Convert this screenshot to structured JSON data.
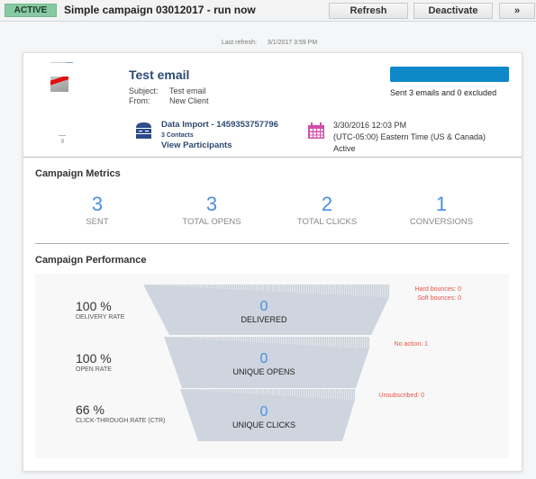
{
  "toolbar": {
    "status": "ACTIVE",
    "campaign_name": "Simple campaign 03012017 - run now",
    "refresh_label": "Refresh",
    "deactivate_label": "Deactivate",
    "more_label": "»"
  },
  "last_refresh": {
    "label": "Last refresh:",
    "value": "3/1/2017 3:59 PM"
  },
  "email": {
    "title": "Test email",
    "subject_label": "Subject:",
    "subject": "Test email",
    "from_label": "From:",
    "from": "New Client"
  },
  "send_status": {
    "progress_percent": 100,
    "text": "Sent 3 emails and 0 excluded",
    "color": "#0f88c8"
  },
  "audience": {
    "icon": "database-icon",
    "name": "Data Import - 1459353757796",
    "contacts": "3 Contacts",
    "view_participants": "View Participants"
  },
  "schedule": {
    "icon": "calendar-icon",
    "datetime": "3/30/2016 12:03 PM",
    "timezone": "(UTC-05:00) Eastern Time (US & Canada)",
    "state": "Active"
  },
  "metrics": {
    "title": "Campaign Metrics",
    "items": [
      {
        "value": "3",
        "label": "SENT"
      },
      {
        "value": "3",
        "label": "TOTAL OPENS"
      },
      {
        "value": "2",
        "label": "TOTAL CLICKS"
      },
      {
        "value": "1",
        "label": "CONVERSIONS"
      }
    ]
  },
  "performance": {
    "title": "Campaign Performance",
    "stages": [
      {
        "rate": "100 %",
        "rate_label": "DELIVERY RATE",
        "value": "0",
        "label": "DELIVERED",
        "notes": [
          "Hard bounces: 0",
          "Soft bounces: 0"
        ]
      },
      {
        "rate": "100 %",
        "rate_label": "OPEN RATE",
        "value": "0",
        "label": "UNIQUE OPENS",
        "notes": [
          "No action: 1"
        ]
      },
      {
        "rate": "66 %",
        "rate_label": "CLICK-THROUGH RATE (CTR)",
        "value": "0",
        "label": "UNIQUE CLICKS",
        "notes": [
          "Unsubscribed: 0"
        ]
      }
    ]
  }
}
